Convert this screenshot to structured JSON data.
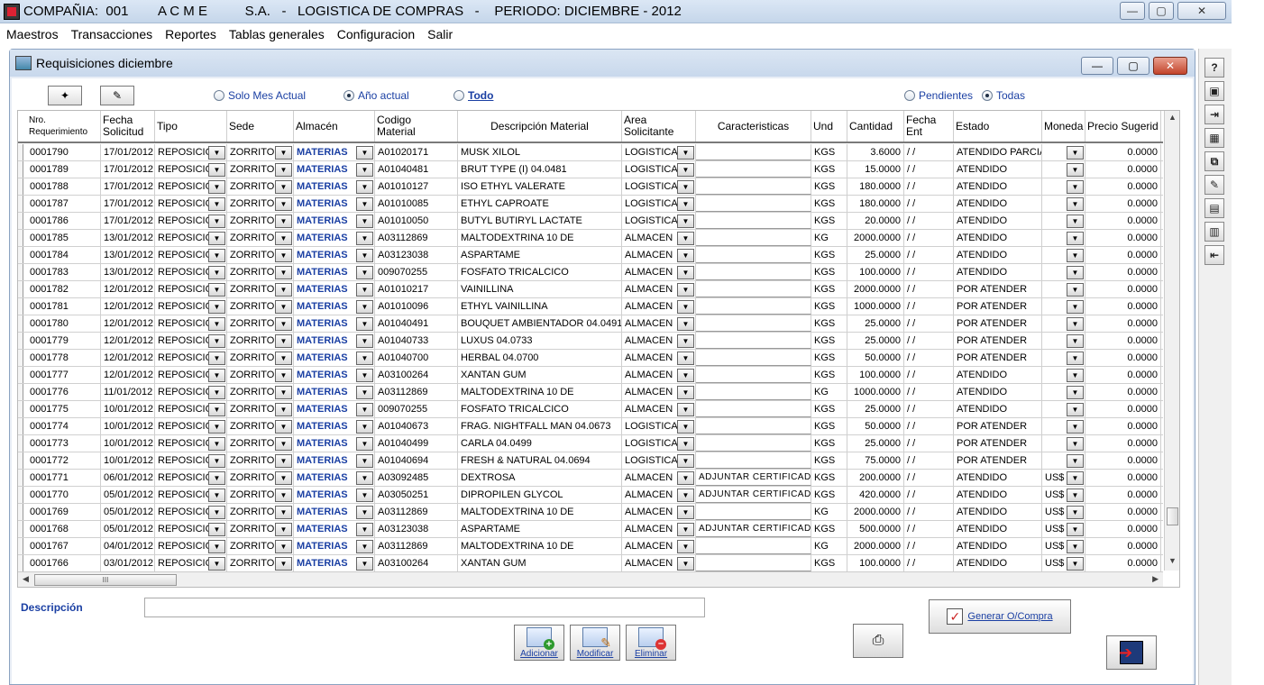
{
  "app": {
    "title": "COMPAÑIA:  001        A C M E          S.A.   -   LOGISTICA DE COMPRAS   -    PERIODO: DICIEMBRE - 2012",
    "window_buttons": [
      "—",
      "▢",
      "✕"
    ]
  },
  "menu": [
    "Maestros",
    "Transacciones",
    "Reportes",
    "Tablas generales",
    "Configuracion",
    "Salir"
  ],
  "child": {
    "title": "Requisiciones diciembre"
  },
  "filters": {
    "solo_mes": "Solo Mes Actual",
    "anio_actual": "Año actual",
    "todo": "Todo",
    "pendientes": "Pendientes",
    "todas": "Todas",
    "selected_period": "Año actual",
    "selected_status": "Todas"
  },
  "grid": {
    "headers": [
      "Nro.\nRequerimiento",
      "Fecha\nSolicitud",
      "Tipo",
      "Sede",
      "Almacén",
      "Codigo\nMaterial",
      "Descripción Material",
      "Area\nSolicitante",
      "Caracteristicas",
      "Und",
      "Cantidad",
      "Fecha Ent",
      "Estado",
      "Moneda",
      "Precio Sugerid"
    ],
    "rows": [
      [
        "0001790",
        "17/01/2012",
        "REPOSICIO",
        "ZORRITO",
        "MATERIAS",
        "A01020171",
        "MUSK XILOL",
        "LOGISTICA",
        "",
        "KGS",
        "3.6000",
        "/ /",
        "ATENDIDO PARCIAL",
        "",
        "0.0000"
      ],
      [
        "0001789",
        "17/01/2012",
        "REPOSICIO",
        "ZORRITO",
        "MATERIAS",
        "A01040481",
        "BRUT TYPE (I)  04.0481",
        "LOGISTICA",
        "",
        "KGS",
        "15.0000",
        "/ /",
        "ATENDIDO",
        "",
        "0.0000"
      ],
      [
        "0001788",
        "17/01/2012",
        "REPOSICIO",
        "ZORRITO",
        "MATERIAS",
        "A01010127",
        "ISO ETHYL VALERATE",
        "LOGISTICA",
        "",
        "KGS",
        "180.0000",
        "/ /",
        "ATENDIDO",
        "",
        "0.0000"
      ],
      [
        "0001787",
        "17/01/2012",
        "REPOSICIO",
        "ZORRITO",
        "MATERIAS",
        "A01010085",
        "ETHYL CAPROATE",
        "LOGISTICA",
        "",
        "KGS",
        "180.0000",
        "/ /",
        "ATENDIDO",
        "",
        "0.0000"
      ],
      [
        "0001786",
        "17/01/2012",
        "REPOSICIO",
        "ZORRITO",
        "MATERIAS",
        "A01010050",
        "BUTYL BUTIRYL LACTATE",
        "LOGISTICA",
        "",
        "KGS",
        "20.0000",
        "/ /",
        "ATENDIDO",
        "",
        "0.0000"
      ],
      [
        "0001785",
        "13/01/2012",
        "REPOSICIO",
        "ZORRITO",
        "MATERIAS",
        "A03112869",
        "MALTODEXTRINA 10 DE",
        "ALMACEN",
        "",
        "KG",
        "2000.0000",
        "/ /",
        "ATENDIDO",
        "",
        "0.0000"
      ],
      [
        "0001784",
        "13/01/2012",
        "REPOSICIO",
        "ZORRITO",
        "MATERIAS",
        "A03123038",
        "ASPARTAME",
        "ALMACEN",
        "",
        "KGS",
        "25.0000",
        "/ /",
        "ATENDIDO",
        "",
        "0.0000"
      ],
      [
        "0001783",
        "13/01/2012",
        "REPOSICIO",
        "ZORRITO",
        "MATERIAS",
        "009070255",
        "FOSFATO TRICALCICO",
        "ALMACEN",
        "",
        "KGS",
        "100.0000",
        "/ /",
        "ATENDIDO",
        "",
        "0.0000"
      ],
      [
        "0001782",
        "12/01/2012",
        "REPOSICIO",
        "ZORRITO",
        "MATERIAS",
        "A01010217",
        "VAINILLINA",
        "ALMACEN",
        "",
        "KGS",
        "2000.0000",
        "/ /",
        "POR ATENDER",
        "",
        "0.0000"
      ],
      [
        "0001781",
        "12/01/2012",
        "REPOSICIO",
        "ZORRITO",
        "MATERIAS",
        "A01010096",
        "ETHYL VAINILLINA",
        "ALMACEN",
        "",
        "KGS",
        "1000.0000",
        "/ /",
        "POR ATENDER",
        "",
        "0.0000"
      ],
      [
        "0001780",
        "12/01/2012",
        "REPOSICIO",
        "ZORRITO",
        "MATERIAS",
        "A01040491",
        "BOUQUET AMBIENTADOR  04.0491",
        "ALMACEN",
        "",
        "KGS",
        "25.0000",
        "/ /",
        "POR ATENDER",
        "",
        "0.0000"
      ],
      [
        "0001779",
        "12/01/2012",
        "REPOSICIO",
        "ZORRITO",
        "MATERIAS",
        "A01040733",
        "LUXUS 04.0733",
        "ALMACEN",
        "",
        "KGS",
        "25.0000",
        "/ /",
        "POR ATENDER",
        "",
        "0.0000"
      ],
      [
        "0001778",
        "12/01/2012",
        "REPOSICIO",
        "ZORRITO",
        "MATERIAS",
        "A01040700",
        "HERBAL 04.0700",
        "ALMACEN",
        "",
        "KGS",
        "50.0000",
        "/ /",
        "POR ATENDER",
        "",
        "0.0000"
      ],
      [
        "0001777",
        "12/01/2012",
        "REPOSICIO",
        "ZORRITO",
        "MATERIAS",
        "A03100264",
        "XANTAN GUM",
        "ALMACEN",
        "",
        "KGS",
        "100.0000",
        "/ /",
        "ATENDIDO",
        "",
        "0.0000"
      ],
      [
        "0001776",
        "11/01/2012",
        "REPOSICIO",
        "ZORRITO",
        "MATERIAS",
        "A03112869",
        "MALTODEXTRINA 10 DE",
        "ALMACEN",
        "",
        "KG",
        "1000.0000",
        "/ /",
        "ATENDIDO",
        "",
        "0.0000"
      ],
      [
        "0001775",
        "10/01/2012",
        "REPOSICIO",
        "ZORRITO",
        "MATERIAS",
        "009070255",
        "FOSFATO TRICALCICO",
        "ALMACEN",
        "",
        "KGS",
        "25.0000",
        "/ /",
        "ATENDIDO",
        "",
        "0.0000"
      ],
      [
        "0001774",
        "10/01/2012",
        "REPOSICIO",
        "ZORRITO",
        "MATERIAS",
        "A01040673",
        "FRAG. NIGHTFALL MAN 04.0673",
        "LOGISTICA",
        "",
        "KGS",
        "50.0000",
        "/ /",
        "POR ATENDER",
        "",
        "0.0000"
      ],
      [
        "0001773",
        "10/01/2012",
        "REPOSICIO",
        "ZORRITO",
        "MATERIAS",
        "A01040499",
        "CARLA 04.0499",
        "LOGISTICA",
        "",
        "KGS",
        "25.0000",
        "/ /",
        "POR ATENDER",
        "",
        "0.0000"
      ],
      [
        "0001772",
        "10/01/2012",
        "REPOSICIO",
        "ZORRITO",
        "MATERIAS",
        "A01040694",
        "FRESH & NATURAL  04.0694",
        "LOGISTICA",
        "",
        "KGS",
        "75.0000",
        "/ /",
        "POR ATENDER",
        "",
        "0.0000"
      ],
      [
        "0001771",
        "06/01/2012",
        "REPOSICIO",
        "ZORRITO",
        "MATERIAS",
        "A03092485",
        "DEXTROSA",
        "ALMACEN",
        "ADJUNTAR CERTIFICADO",
        "KGS",
        "200.0000",
        "/ /",
        "ATENDIDO",
        "US$",
        "0.0000"
      ],
      [
        "0001770",
        "05/01/2012",
        "REPOSICIO",
        "ZORRITO",
        "MATERIAS",
        "A03050251",
        "DIPROPILEN GLYCOL",
        "ALMACEN",
        "ADJUNTAR CERTIFICADO",
        "KGS",
        "420.0000",
        "/ /",
        "ATENDIDO",
        "US$",
        "0.0000"
      ],
      [
        "0001769",
        "05/01/2012",
        "REPOSICIO",
        "ZORRITO",
        "MATERIAS",
        "A03112869",
        "MALTODEXTRINA 10 DE",
        "ALMACEN",
        "",
        "KG",
        "2000.0000",
        "/ /",
        "ATENDIDO",
        "US$",
        "0.0000"
      ],
      [
        "0001768",
        "05/01/2012",
        "REPOSICIO",
        "ZORRITO",
        "MATERIAS",
        "A03123038",
        "ASPARTAME",
        "ALMACEN",
        "ADJUNTAR CERTIFICADO",
        "KGS",
        "500.0000",
        "/ /",
        "ATENDIDO",
        "US$",
        "0.0000"
      ],
      [
        "0001767",
        "04/01/2012",
        "REPOSICIO",
        "ZORRITO",
        "MATERIAS",
        "A03112869",
        "MALTODEXTRINA 10 DE",
        "ALMACEN",
        "",
        "KG",
        "2000.0000",
        "/ /",
        "ATENDIDO",
        "US$",
        "0.0000"
      ],
      [
        "0001766",
        "03/01/2012",
        "REPOSICIO",
        "ZORRITO",
        "MATERIAS",
        "A03100264",
        "XANTAN GUM",
        "ALMACEN",
        "",
        "KGS",
        "100.0000",
        "/ /",
        "ATENDIDO",
        "US$",
        "0.0000"
      ]
    ],
    "hscroll_thumb": "III"
  },
  "bottom": {
    "descripcion_label": "Descripción",
    "descripcion_value": "",
    "adicionar": "Adicionar",
    "modificar": "Modificar",
    "eliminar": "Eliminar",
    "generar": "Generar O/Compra"
  },
  "colors": {
    "link_blue": "#1a3fa3",
    "title_bar": "#c8d8ec",
    "close_red": "#c3442b"
  }
}
